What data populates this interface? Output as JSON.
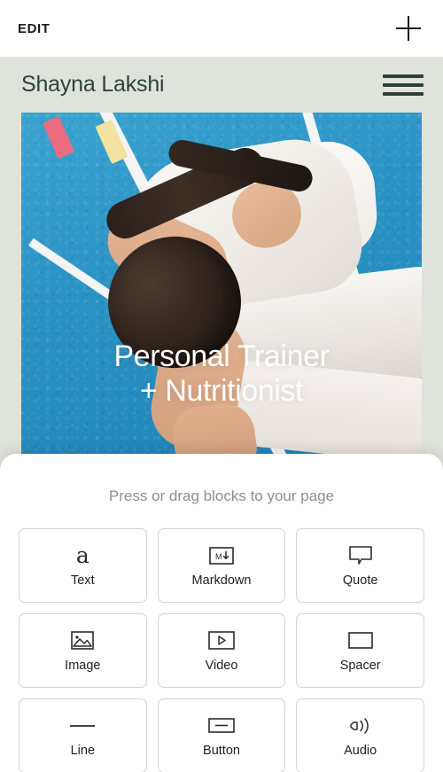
{
  "editor_bar": {
    "edit_label": "EDIT",
    "add_icon": "plus-icon"
  },
  "site": {
    "title": "Shayna Lakshi",
    "menu_icon": "hamburger-menu-icon",
    "header_bg": "#dfe3dc",
    "title_color": "#2f4238",
    "hero": {
      "headline_line1": "Personal Trainer",
      "headline_line2": "+ Nutritionist",
      "image_alt": "Athlete stretching on a blue running track",
      "track_color": "#2a93c4"
    }
  },
  "sheet": {
    "hint": "Press or drag blocks to your page",
    "blocks": [
      {
        "label": "Text",
        "icon": "letter-a-icon"
      },
      {
        "label": "Markdown",
        "icon": "markdown-icon"
      },
      {
        "label": "Quote",
        "icon": "speech-bubble-icon"
      },
      {
        "label": "Image",
        "icon": "image-icon"
      },
      {
        "label": "Video",
        "icon": "video-play-icon"
      },
      {
        "label": "Spacer",
        "icon": "rectangle-icon"
      },
      {
        "label": "Line",
        "icon": "horizontal-line-icon"
      },
      {
        "label": "Button",
        "icon": "button-icon"
      },
      {
        "label": "Audio",
        "icon": "speaker-icon"
      }
    ]
  }
}
